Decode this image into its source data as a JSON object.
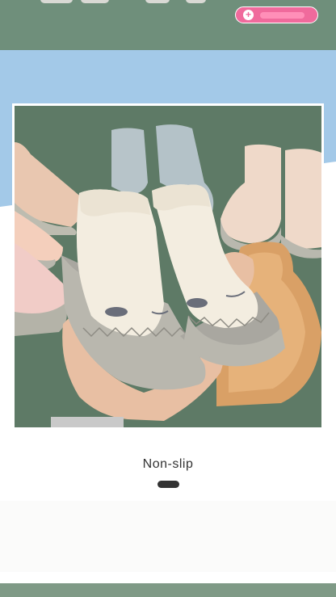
{
  "caption": "Non-slip",
  "colors": {
    "accent_pill": "#f06a9c",
    "background_green": "#6f8f7b",
    "band_blue": "#a3c9e8",
    "indicator": "#333333"
  },
  "icons": {
    "pill_icon": "plus-circle-icon"
  },
  "carousel": {
    "active_index": 0
  }
}
